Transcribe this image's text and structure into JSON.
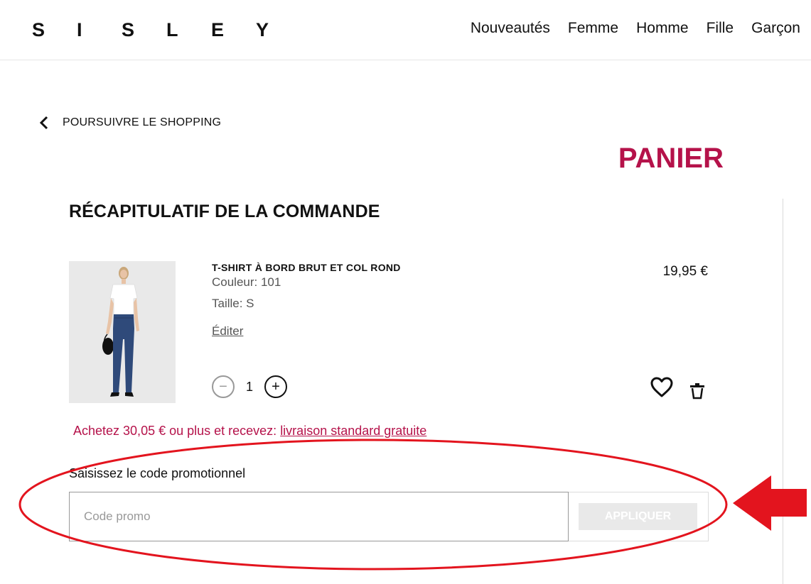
{
  "header": {
    "logo_letters": [
      "S",
      "I",
      "S",
      "L",
      "E",
      "Y"
    ],
    "nav": [
      "Nouveautés",
      "Femme",
      "Homme",
      "Fille",
      "Garçon"
    ]
  },
  "back": {
    "label": "POURSUIVRE LE SHOPPING"
  },
  "page_title": "PANIER",
  "summary_title": "RÉCAPITULATIF DE LA COMMANDE",
  "product": {
    "name": "T-SHIRT À BORD BRUT ET COL ROND",
    "color": "Couleur: 101",
    "size": "Taille: S",
    "edit": "Éditer",
    "price": "19,95 €",
    "quantity": "1",
    "minus": "−",
    "plus": "+"
  },
  "promo": {
    "banner_prefix": "Achetez 30,05 € ou plus et recevez: ",
    "banner_link": "livraison standard gratuite",
    "label": "Saisissez le code promotionnel",
    "placeholder": "Code promo",
    "apply": "APPLIQUER"
  },
  "colors": {
    "accent": "#b5124a",
    "annotation": "#e3141e"
  },
  "icons": {
    "back": "chevron-left-icon",
    "wishlist": "heart-icon",
    "delete": "trash-icon"
  }
}
